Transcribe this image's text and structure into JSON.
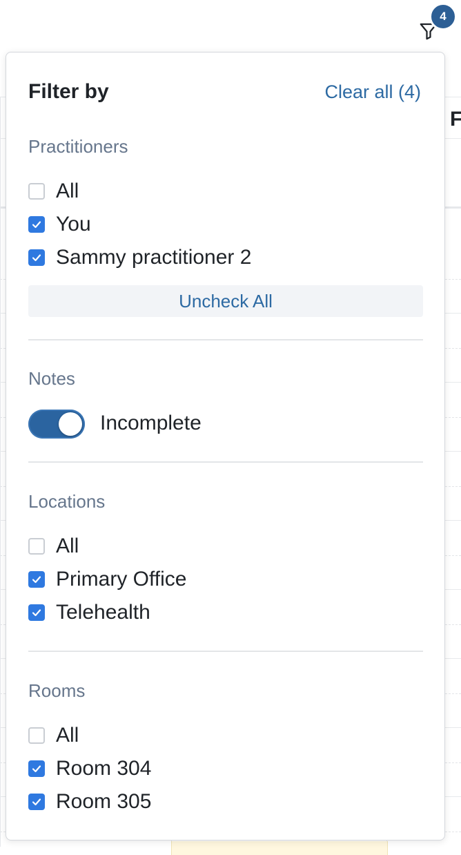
{
  "filter_button": {
    "icon": "filter-icon",
    "badge_count": "4",
    "badge_color": "#2d5f95"
  },
  "panel": {
    "title": "Filter by",
    "clear_all_label": "Clear all (4)"
  },
  "background": {
    "column_header_fragment": "F"
  },
  "practitioners": {
    "title": "Practitioners",
    "options": [
      {
        "label": "All",
        "checked": false
      },
      {
        "label": "You",
        "checked": true
      },
      {
        "label": "Sammy practitioner 2",
        "checked": true
      }
    ],
    "uncheck_all_label": "Uncheck All"
  },
  "notes": {
    "title": "Notes",
    "toggle_label": "Incomplete",
    "toggle_on": true
  },
  "locations": {
    "title": "Locations",
    "options": [
      {
        "label": "All",
        "checked": false
      },
      {
        "label": "Primary Office",
        "checked": true
      },
      {
        "label": "Telehealth",
        "checked": true
      }
    ]
  },
  "rooms": {
    "title": "Rooms",
    "options": [
      {
        "label": "All",
        "checked": false
      },
      {
        "label": "Room 304",
        "checked": true
      },
      {
        "label": "Room 305",
        "checked": true
      }
    ]
  },
  "colors": {
    "accent": "#2d6aa3",
    "checkbox_checked": "#2f79e0",
    "toggle_on": "#2b64a0",
    "section_title": "#66768c"
  }
}
